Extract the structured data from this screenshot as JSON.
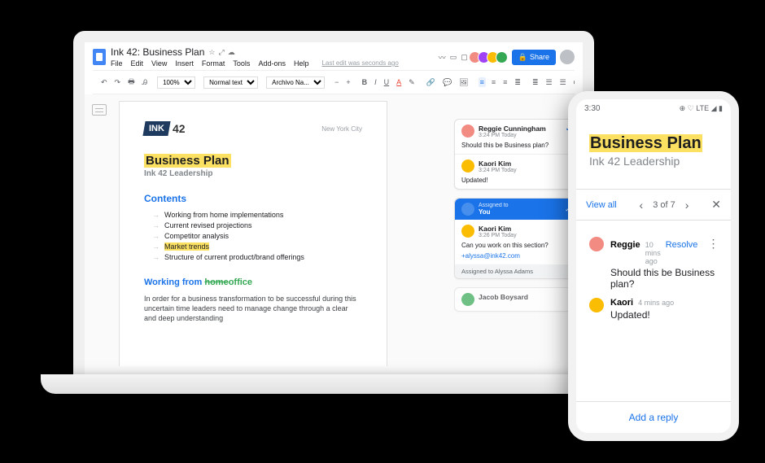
{
  "docs": {
    "title": "Ink 42: Business Plan",
    "menu": [
      "File",
      "Edit",
      "View",
      "Insert",
      "Format",
      "Tools",
      "Add-ons",
      "Help"
    ],
    "last_edit": "Last edit was seconds ago",
    "share": "Share",
    "toolbar": {
      "zoom": "100%",
      "style": "Normal text",
      "font": "Archivo Na..."
    }
  },
  "page": {
    "brand_ink": "INK",
    "brand_num": "42",
    "location": "New York City",
    "h1": "Business Plan",
    "sub": "Ink 42 Leadership",
    "contents_label": "Contents",
    "contents": [
      "Working from home implementations",
      "Current revised projections",
      "Competitor analysis",
      "Market trends",
      "Structure of current product/brand offerings"
    ],
    "section_h": {
      "pre": "Working from ",
      "strike": "home",
      "after": "office"
    },
    "para": "In order for a business transformation to be successful during this uncertain time leaders need to manage change through a clear and deep understanding"
  },
  "comments": {
    "c1": {
      "name": "Reggie Cunningham",
      "time": "3:24 PM Today",
      "body": "Should this be Business plan?"
    },
    "c2": {
      "name": "Kaori Kim",
      "time": "3:24 PM Today",
      "body": "Updated!"
    },
    "assigned": {
      "label": "Assigned to",
      "who": "You",
      "name": "Kaori Kim",
      "time": "3:26 PM Today",
      "body": "Can you work on this section?",
      "mention": "+alyssa@ink42.com",
      "footer": "Assigned to Alyssa Adams"
    },
    "c3_name": "Jacob Boysard"
  },
  "phone": {
    "time": "3:30",
    "status_icons": "⊕ ♡ LTE ◢ ▮",
    "h1": "Business Plan",
    "sub": "Ink 42 Leadership",
    "nav": {
      "view_all": "View all",
      "counter": "3 of 7"
    },
    "c1": {
      "name": "Reggie",
      "time": "10 mins ago",
      "body": "Should this be Business plan?"
    },
    "c2": {
      "name": "Kaori",
      "time": "4 mins ago",
      "body": "Updated!"
    },
    "resolve": "Resolve",
    "reply": "Add a reply"
  }
}
